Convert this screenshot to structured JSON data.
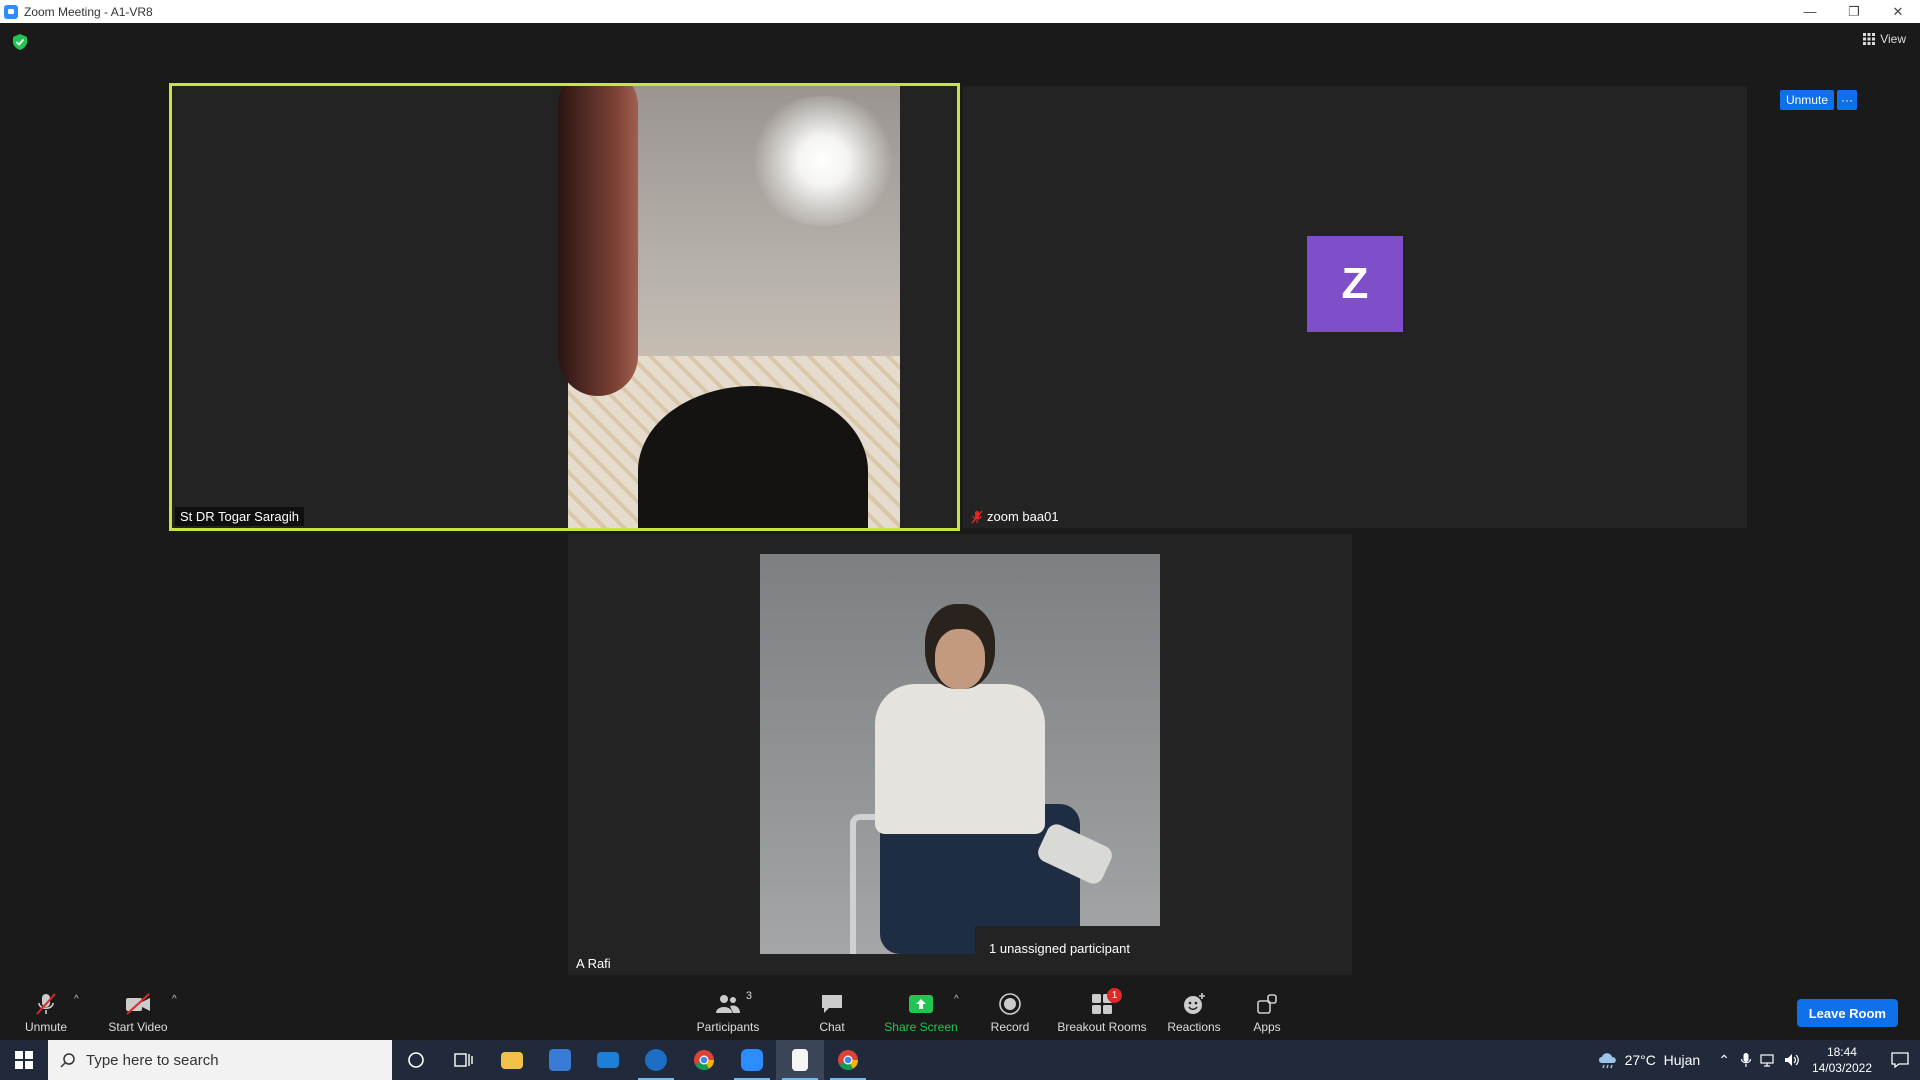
{
  "window": {
    "title": "Zoom Meeting - A1-VR8",
    "minimize": "—",
    "restore": "❐",
    "close": "✕"
  },
  "view_button": {
    "label": "View"
  },
  "tiles": {
    "speaker": {
      "name": "St DR Togar Saragih"
    },
    "zoom_baa01": {
      "name": "zoom baa01",
      "avatar_letter": "Z",
      "unmute_label": "Unmute",
      "more_label": "···",
      "avatar_color": "#7f4fc9"
    },
    "a_rafi": {
      "name": "A Rafi"
    }
  },
  "tooltip": {
    "text": "1 unassigned participant"
  },
  "toolbar": {
    "unmute": "Unmute",
    "start_video": "Start Video",
    "participants": "Participants",
    "participants_count": "3",
    "chat": "Chat",
    "share_screen": "Share Screen",
    "record": "Record",
    "breakout_rooms": "Breakout Rooms",
    "breakout_badge": "1",
    "reactions": "Reactions",
    "apps": "Apps",
    "leave_room": "Leave Room"
  },
  "taskbar": {
    "search_placeholder": "Type here to search",
    "weather": "27°C  Hujan",
    "time": "18:44",
    "date": "14/03/2022"
  },
  "colors": {
    "active_border": "#c6e348",
    "accent_blue": "#0e71eb",
    "share_green": "#23c552",
    "badge_red": "#e02828"
  }
}
